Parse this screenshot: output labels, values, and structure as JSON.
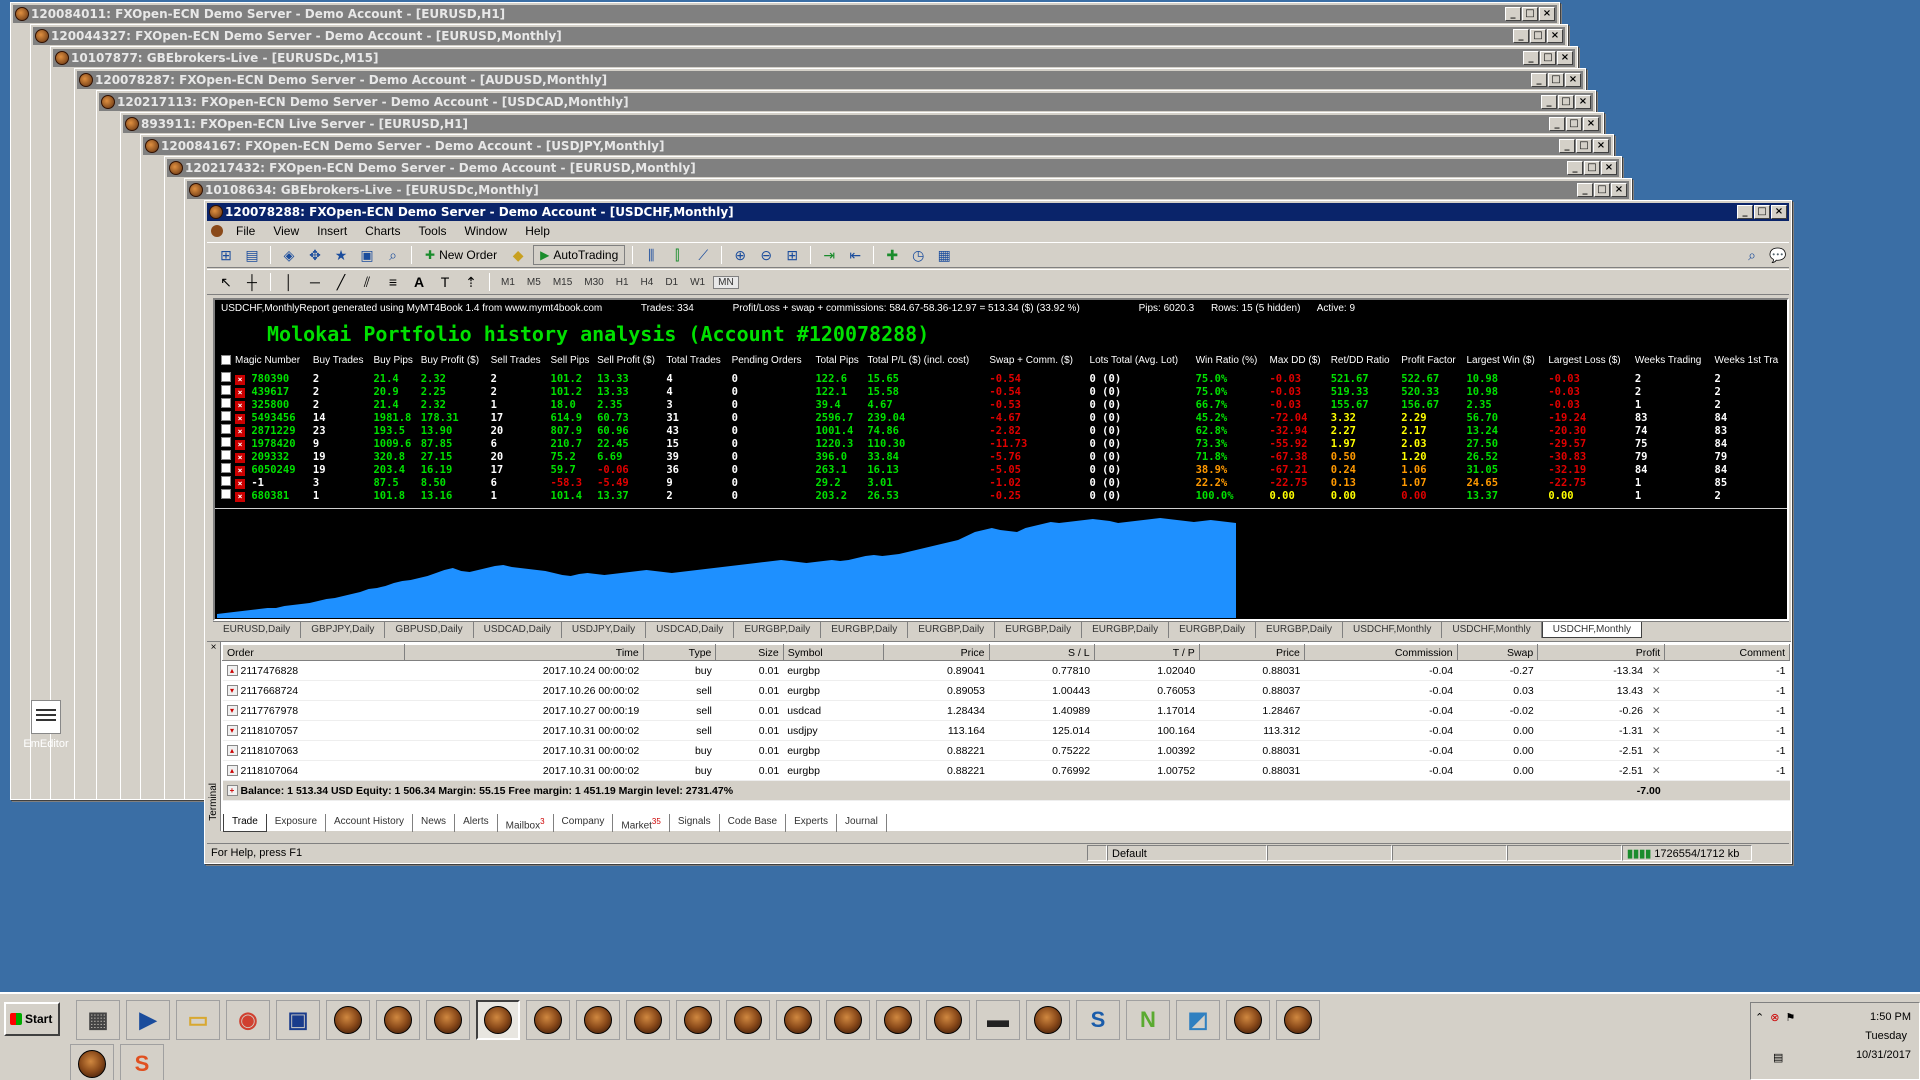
{
  "bg_windows": [
    {
      "title": "120084011: FXOpen-ECN Demo Server - Demo Account - [EURUSD,H1]"
    },
    {
      "title": "120044327: FXOpen-ECN Demo Server - Demo Account - [EURUSD,Monthly]"
    },
    {
      "title": "10107877: GBEbrokers-Live - [EURUSDc,M15]"
    },
    {
      "title": "120078287: FXOpen-ECN Demo Server - Demo Account - [AUDUSD,Monthly]"
    },
    {
      "title": "120217113: FXOpen-ECN Demo Server - Demo Account - [USDCAD,Monthly]"
    },
    {
      "title": "893911: FXOpen-ECN Live Server - [EURUSD,H1]"
    },
    {
      "title": "120084167: FXOpen-ECN Demo Server - Demo Account - [USDJPY,Monthly]"
    },
    {
      "title": "120217432: FXOpen-ECN Demo Server - Demo Account - [EURUSD,Monthly]"
    },
    {
      "title": "10108634: GBEbrokers-Live - [EURUSDc,Monthly]"
    }
  ],
  "main_window": {
    "title": "120078288: FXOpen-ECN Demo Server - Demo Account - [USDCHF,Monthly]"
  },
  "menu": [
    "File",
    "View",
    "Insert",
    "Charts",
    "Tools",
    "Window",
    "Help"
  ],
  "toolbar": {
    "new_order": "New Order",
    "autotrading": "AutoTrading"
  },
  "timeframes": [
    "M1",
    "M5",
    "M15",
    "M30",
    "H1",
    "H4",
    "D1",
    "W1",
    "MN"
  ],
  "report": {
    "header_left": "USDCHF,MonthlyReport generated using MyMT4Book 1.4 from www.mymt4book.com",
    "trades": "Trades: 334",
    "profit_line": "Profit/Loss + swap + commissions: 584.67-58.36-12.97 = 513.34 ($) (33.92 %)",
    "pips": "Pips: 6020.3",
    "rows": "Rows: 15 (5 hidden)",
    "active": "Active: 9",
    "title": "Molokai Portfolio history analysis (Account #120078288)",
    "columns": [
      "Magic Number",
      "Buy Trades",
      "Buy Pips",
      "Buy Profit ($)",
      "Sell Trades",
      "Sell Pips",
      "Sell Profit ($)",
      "Total Trades",
      "Pending Orders",
      "Total Pips",
      "Total P/L ($) (incl. cost)",
      "Swap + Comm. ($)",
      "Lots Total (Avg. Lot)",
      "Win Ratio (%)",
      "Max DD ($)",
      "Ret/DD Ratio",
      "Profit Factor",
      "Largest Win ($)",
      "Largest Loss ($)",
      "Weeks Trading",
      "Weeks 1st Tra"
    ],
    "rows_data": [
      {
        "cells": [
          "780390",
          "2",
          "21.4",
          "2.32",
          "2",
          "101.2",
          "13.33",
          "4",
          "0",
          "122.6",
          "15.65",
          "-0.54",
          "0 (0)",
          "75.0%",
          "-0.03",
          "521.67",
          "522.67",
          "10.98",
          "-0.03",
          "2",
          "2"
        ],
        "colors": [
          "g",
          "w",
          "g",
          "g",
          "w",
          "g",
          "g",
          "w",
          "w",
          "g",
          "g",
          "r",
          "w",
          "g",
          "r",
          "g",
          "g",
          "g",
          "r",
          "w",
          "w"
        ]
      },
      {
        "cells": [
          "439617",
          "2",
          "20.9",
          "2.25",
          "2",
          "101.2",
          "13.33",
          "4",
          "0",
          "122.1",
          "15.58",
          "-0.54",
          "0 (0)",
          "75.0%",
          "-0.03",
          "519.33",
          "520.33",
          "10.98",
          "-0.03",
          "2",
          "2"
        ],
        "colors": [
          "g",
          "w",
          "g",
          "g",
          "w",
          "g",
          "g",
          "w",
          "w",
          "g",
          "g",
          "r",
          "w",
          "g",
          "r",
          "g",
          "g",
          "g",
          "r",
          "w",
          "w"
        ]
      },
      {
        "cells": [
          "325800",
          "2",
          "21.4",
          "2.32",
          "1",
          "18.0",
          "2.35",
          "3",
          "0",
          "39.4",
          "4.67",
          "-0.53",
          "0 (0)",
          "66.7%",
          "-0.03",
          "155.67",
          "156.67",
          "2.35",
          "-0.03",
          "1",
          "2"
        ],
        "colors": [
          "g",
          "w",
          "g",
          "g",
          "w",
          "g",
          "g",
          "w",
          "w",
          "g",
          "g",
          "r",
          "w",
          "g",
          "r",
          "g",
          "g",
          "g",
          "r",
          "w",
          "w"
        ]
      },
      {
        "cells": [
          "5493456",
          "14",
          "1981.8",
          "178.31",
          "17",
          "614.9",
          "60.73",
          "31",
          "0",
          "2596.7",
          "239.04",
          "-4.67",
          "0 (0)",
          "45.2%",
          "-72.04",
          "3.32",
          "2.29",
          "56.70",
          "-19.24",
          "83",
          "84"
        ],
        "colors": [
          "g",
          "w",
          "g",
          "g",
          "w",
          "g",
          "g",
          "w",
          "w",
          "g",
          "g",
          "r",
          "w",
          "g",
          "r",
          "y",
          "y",
          "g",
          "r",
          "w",
          "w"
        ]
      },
      {
        "cells": [
          "2871229",
          "23",
          "193.5",
          "13.90",
          "20",
          "807.9",
          "60.96",
          "43",
          "0",
          "1001.4",
          "74.86",
          "-2.82",
          "0 (0)",
          "62.8%",
          "-32.94",
          "2.27",
          "2.17",
          "13.24",
          "-20.30",
          "74",
          "83"
        ],
        "colors": [
          "g",
          "w",
          "g",
          "g",
          "w",
          "g",
          "g",
          "w",
          "w",
          "g",
          "g",
          "r",
          "w",
          "g",
          "r",
          "y",
          "y",
          "g",
          "r",
          "w",
          "w"
        ]
      },
      {
        "cells": [
          "1978420",
          "9",
          "1009.6",
          "87.85",
          "6",
          "210.7",
          "22.45",
          "15",
          "0",
          "1220.3",
          "110.30",
          "-11.73",
          "0 (0)",
          "73.3%",
          "-55.92",
          "1.97",
          "2.03",
          "27.50",
          "-29.57",
          "75",
          "84"
        ],
        "colors": [
          "g",
          "w",
          "g",
          "g",
          "w",
          "g",
          "g",
          "w",
          "w",
          "g",
          "g",
          "r",
          "w",
          "g",
          "r",
          "y",
          "y",
          "g",
          "r",
          "w",
          "w"
        ]
      },
      {
        "cells": [
          "209332",
          "19",
          "320.8",
          "27.15",
          "20",
          "75.2",
          "6.69",
          "39",
          "0",
          "396.0",
          "33.84",
          "-5.76",
          "0 (0)",
          "71.8%",
          "-67.38",
          "0.50",
          "1.20",
          "26.52",
          "-30.83",
          "79",
          "79"
        ],
        "colors": [
          "g",
          "w",
          "g",
          "g",
          "w",
          "g",
          "g",
          "w",
          "w",
          "g",
          "g",
          "r",
          "w",
          "g",
          "r",
          "o",
          "y",
          "g",
          "r",
          "w",
          "w"
        ]
      },
      {
        "cells": [
          "6050249",
          "19",
          "203.4",
          "16.19",
          "17",
          "59.7",
          "-0.06",
          "36",
          "0",
          "263.1",
          "16.13",
          "-5.05",
          "0 (0)",
          "38.9%",
          "-67.21",
          "0.24",
          "1.06",
          "31.05",
          "-32.19",
          "84",
          "84"
        ],
        "colors": [
          "g",
          "w",
          "g",
          "g",
          "w",
          "g",
          "r",
          "w",
          "w",
          "g",
          "g",
          "r",
          "w",
          "o",
          "r",
          "o",
          "o",
          "g",
          "r",
          "w",
          "w"
        ]
      },
      {
        "cells": [
          "-1",
          "3",
          "87.5",
          "8.50",
          "6",
          "-58.3",
          "-5.49",
          "9",
          "0",
          "29.2",
          "3.01",
          "-1.02",
          "0 (0)",
          "22.2%",
          "-22.75",
          "0.13",
          "1.07",
          "24.65",
          "-22.75",
          "1",
          "85"
        ],
        "colors": [
          "w",
          "w",
          "g",
          "g",
          "w",
          "r",
          "r",
          "w",
          "w",
          "g",
          "g",
          "r",
          "w",
          "o",
          "r",
          "o",
          "o",
          "o",
          "r",
          "w",
          "w"
        ]
      },
      {
        "cells": [
          "680381",
          "1",
          "101.8",
          "13.16",
          "1",
          "101.4",
          "13.37",
          "2",
          "0",
          "203.2",
          "26.53",
          "-0.25",
          "0 (0)",
          "100.0%",
          "0.00",
          "0.00",
          "0.00",
          "13.37",
          "0.00",
          "1",
          "2"
        ],
        "colors": [
          "g",
          "w",
          "g",
          "g",
          "w",
          "g",
          "g",
          "w",
          "w",
          "g",
          "g",
          "r",
          "w",
          "g",
          "y",
          "y",
          "r",
          "g",
          "y",
          "w",
          "w"
        ]
      }
    ]
  },
  "chart_tabs": [
    "EURUSD,Daily",
    "GBPJPY,Daily",
    "GBPUSD,Daily",
    "USDCAD,Daily",
    "USDJPY,Daily",
    "USDCAD,Daily",
    "EURGBP,Daily",
    "EURGBP,Daily",
    "EURGBP,Daily",
    "EURGBP,Daily",
    "EURGBP,Daily",
    "EURGBP,Daily",
    "EURGBP,Daily",
    "USDCHF,Monthly",
    "USDCHF,Monthly",
    "USDCHF,Monthly"
  ],
  "terminal": {
    "columns": [
      "Order",
      "Time",
      "Type",
      "Size",
      "Symbol",
      "Price",
      "S / L",
      "T / P",
      "Price",
      "Commission",
      "Swap",
      "Profit",
      "Comment"
    ],
    "rows": [
      [
        "2117476828",
        "2017.10.24 00:00:02",
        "buy",
        "0.01",
        "eurgbp",
        "0.89041",
        "0.77810",
        "1.02040",
        "0.88031",
        "-0.04",
        "-0.27",
        "-13.34",
        "-1"
      ],
      [
        "2117668724",
        "2017.10.26 00:00:02",
        "sell",
        "0.01",
        "eurgbp",
        "0.89053",
        "1.00443",
        "0.76053",
        "0.88037",
        "-0.04",
        "0.03",
        "13.43",
        "-1"
      ],
      [
        "2117767978",
        "2017.10.27 00:00:19",
        "sell",
        "0.01",
        "usdcad",
        "1.28434",
        "1.40989",
        "1.17014",
        "1.28467",
        "-0.04",
        "-0.02",
        "-0.26",
        "-1"
      ],
      [
        "2118107057",
        "2017.10.31 00:00:02",
        "sell",
        "0.01",
        "usdjpy",
        "113.164",
        "125.014",
        "100.164",
        "113.312",
        "-0.04",
        "0.00",
        "-1.31",
        "-1"
      ],
      [
        "2118107063",
        "2017.10.31 00:00:02",
        "buy",
        "0.01",
        "eurgbp",
        "0.88221",
        "0.75222",
        "1.00392",
        "0.88031",
        "-0.04",
        "0.00",
        "-2.51",
        "-1"
      ],
      [
        "2118107064",
        "2017.10.31 00:00:02",
        "buy",
        "0.01",
        "eurgbp",
        "0.88221",
        "0.76992",
        "1.00752",
        "0.88031",
        "-0.04",
        "0.00",
        "-2.51",
        "-1"
      ]
    ],
    "balance": "Balance: 1 513.34 USD  Equity: 1 506.34  Margin: 55.15  Free margin: 1 451.19  Margin level: 2731.47%",
    "balance_profit": "-7.00",
    "tabs": [
      {
        "label": "Trade",
        "badge": ""
      },
      {
        "label": "Exposure",
        "badge": ""
      },
      {
        "label": "Account History",
        "badge": ""
      },
      {
        "label": "News",
        "badge": ""
      },
      {
        "label": "Alerts",
        "badge": ""
      },
      {
        "label": "Mailbox",
        "badge": "3"
      },
      {
        "label": "Company",
        "badge": ""
      },
      {
        "label": "Market",
        "badge": "35"
      },
      {
        "label": "Signals",
        "badge": ""
      },
      {
        "label": "Code Base",
        "badge": ""
      },
      {
        "label": "Experts",
        "badge": ""
      },
      {
        "label": "Journal",
        "badge": ""
      }
    ]
  },
  "status": {
    "help": "For Help, press F1",
    "profile": "Default",
    "traffic": "1726554/1712 kb"
  },
  "side_label": "Terminal",
  "desktop_icon": "EmEditor",
  "taskbar": {
    "start": "Start",
    "time": "1:50 PM",
    "day": "Tuesday",
    "date": "10/31/2017"
  },
  "equity_series": [
    0.04,
    0.05,
    0.06,
    0.07,
    0.08,
    0.09,
    0.1,
    0.1,
    0.12,
    0.13,
    0.14,
    0.15,
    0.17,
    0.19,
    0.2,
    0.22,
    0.24,
    0.26,
    0.29,
    0.3,
    0.32,
    0.35,
    0.37,
    0.38,
    0.4,
    0.42,
    0.45,
    0.48,
    0.5,
    0.47,
    0.46,
    0.48,
    0.5,
    0.52,
    0.53,
    0.51,
    0.5,
    0.49,
    0.48,
    0.47,
    0.45,
    0.43,
    0.42,
    0.44,
    0.45,
    0.44,
    0.43,
    0.44,
    0.45,
    0.46,
    0.47,
    0.48,
    0.47,
    0.46,
    0.45,
    0.46,
    0.47,
    0.48,
    0.49,
    0.5,
    0.51,
    0.52,
    0.53,
    0.54,
    0.55,
    0.56,
    0.57,
    0.58,
    0.57,
    0.56,
    0.55,
    0.56,
    0.57,
    0.58,
    0.57,
    0.58,
    0.6,
    0.62,
    0.63,
    0.62,
    0.63,
    0.64,
    0.66,
    0.68,
    0.7,
    0.72,
    0.74,
    0.76,
    0.78,
    0.82,
    0.86,
    0.88,
    0.9,
    0.88,
    0.87,
    0.86,
    0.9,
    0.92,
    0.94,
    0.96,
    0.95,
    0.96,
    0.97,
    0.98,
    0.99,
    0.98,
    0.97,
    0.95,
    0.96,
    0.97,
    0.98,
    0.99,
    1.0,
    0.99,
    0.98,
    0.97,
    0.96,
    0.97,
    0.98,
    0.97,
    0.96,
    0.95
  ]
}
